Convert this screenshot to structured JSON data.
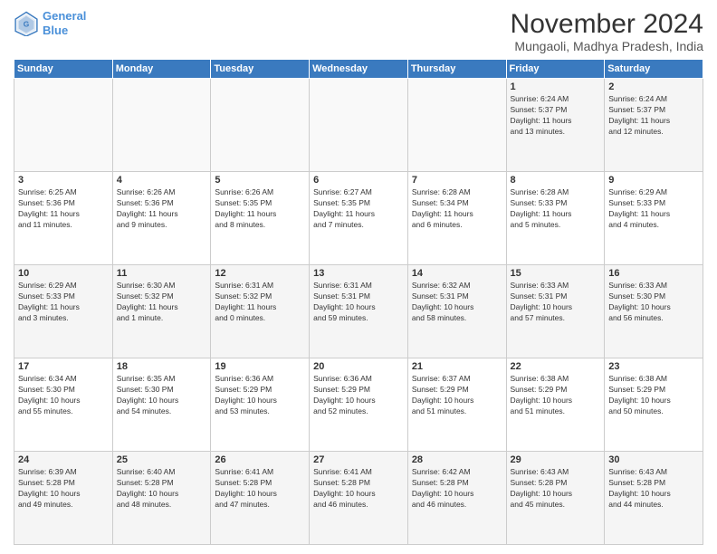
{
  "logo": {
    "line1": "General",
    "line2": "Blue"
  },
  "title": "November 2024",
  "location": "Mungaoli, Madhya Pradesh, India",
  "header": {
    "days": [
      "Sunday",
      "Monday",
      "Tuesday",
      "Wednesday",
      "Thursday",
      "Friday",
      "Saturday"
    ]
  },
  "weeks": [
    {
      "cells": [
        {
          "day": "",
          "info": ""
        },
        {
          "day": "",
          "info": ""
        },
        {
          "day": "",
          "info": ""
        },
        {
          "day": "",
          "info": ""
        },
        {
          "day": "",
          "info": ""
        },
        {
          "day": "1",
          "info": "Sunrise: 6:24 AM\nSunset: 5:37 PM\nDaylight: 11 hours\nand 13 minutes."
        },
        {
          "day": "2",
          "info": "Sunrise: 6:24 AM\nSunset: 5:37 PM\nDaylight: 11 hours\nand 12 minutes."
        }
      ]
    },
    {
      "cells": [
        {
          "day": "3",
          "info": "Sunrise: 6:25 AM\nSunset: 5:36 PM\nDaylight: 11 hours\nand 11 minutes."
        },
        {
          "day": "4",
          "info": "Sunrise: 6:26 AM\nSunset: 5:36 PM\nDaylight: 11 hours\nand 9 minutes."
        },
        {
          "day": "5",
          "info": "Sunrise: 6:26 AM\nSunset: 5:35 PM\nDaylight: 11 hours\nand 8 minutes."
        },
        {
          "day": "6",
          "info": "Sunrise: 6:27 AM\nSunset: 5:35 PM\nDaylight: 11 hours\nand 7 minutes."
        },
        {
          "day": "7",
          "info": "Sunrise: 6:28 AM\nSunset: 5:34 PM\nDaylight: 11 hours\nand 6 minutes."
        },
        {
          "day": "8",
          "info": "Sunrise: 6:28 AM\nSunset: 5:33 PM\nDaylight: 11 hours\nand 5 minutes."
        },
        {
          "day": "9",
          "info": "Sunrise: 6:29 AM\nSunset: 5:33 PM\nDaylight: 11 hours\nand 4 minutes."
        }
      ]
    },
    {
      "cells": [
        {
          "day": "10",
          "info": "Sunrise: 6:29 AM\nSunset: 5:33 PM\nDaylight: 11 hours\nand 3 minutes."
        },
        {
          "day": "11",
          "info": "Sunrise: 6:30 AM\nSunset: 5:32 PM\nDaylight: 11 hours\nand 1 minute."
        },
        {
          "day": "12",
          "info": "Sunrise: 6:31 AM\nSunset: 5:32 PM\nDaylight: 11 hours\nand 0 minutes."
        },
        {
          "day": "13",
          "info": "Sunrise: 6:31 AM\nSunset: 5:31 PM\nDaylight: 10 hours\nand 59 minutes."
        },
        {
          "day": "14",
          "info": "Sunrise: 6:32 AM\nSunset: 5:31 PM\nDaylight: 10 hours\nand 58 minutes."
        },
        {
          "day": "15",
          "info": "Sunrise: 6:33 AM\nSunset: 5:31 PM\nDaylight: 10 hours\nand 57 minutes."
        },
        {
          "day": "16",
          "info": "Sunrise: 6:33 AM\nSunset: 5:30 PM\nDaylight: 10 hours\nand 56 minutes."
        }
      ]
    },
    {
      "cells": [
        {
          "day": "17",
          "info": "Sunrise: 6:34 AM\nSunset: 5:30 PM\nDaylight: 10 hours\nand 55 minutes."
        },
        {
          "day": "18",
          "info": "Sunrise: 6:35 AM\nSunset: 5:30 PM\nDaylight: 10 hours\nand 54 minutes."
        },
        {
          "day": "19",
          "info": "Sunrise: 6:36 AM\nSunset: 5:29 PM\nDaylight: 10 hours\nand 53 minutes."
        },
        {
          "day": "20",
          "info": "Sunrise: 6:36 AM\nSunset: 5:29 PM\nDaylight: 10 hours\nand 52 minutes."
        },
        {
          "day": "21",
          "info": "Sunrise: 6:37 AM\nSunset: 5:29 PM\nDaylight: 10 hours\nand 51 minutes."
        },
        {
          "day": "22",
          "info": "Sunrise: 6:38 AM\nSunset: 5:29 PM\nDaylight: 10 hours\nand 51 minutes."
        },
        {
          "day": "23",
          "info": "Sunrise: 6:38 AM\nSunset: 5:29 PM\nDaylight: 10 hours\nand 50 minutes."
        }
      ]
    },
    {
      "cells": [
        {
          "day": "24",
          "info": "Sunrise: 6:39 AM\nSunset: 5:28 PM\nDaylight: 10 hours\nand 49 minutes."
        },
        {
          "day": "25",
          "info": "Sunrise: 6:40 AM\nSunset: 5:28 PM\nDaylight: 10 hours\nand 48 minutes."
        },
        {
          "day": "26",
          "info": "Sunrise: 6:41 AM\nSunset: 5:28 PM\nDaylight: 10 hours\nand 47 minutes."
        },
        {
          "day": "27",
          "info": "Sunrise: 6:41 AM\nSunset: 5:28 PM\nDaylight: 10 hours\nand 46 minutes."
        },
        {
          "day": "28",
          "info": "Sunrise: 6:42 AM\nSunset: 5:28 PM\nDaylight: 10 hours\nand 46 minutes."
        },
        {
          "day": "29",
          "info": "Sunrise: 6:43 AM\nSunset: 5:28 PM\nDaylight: 10 hours\nand 45 minutes."
        },
        {
          "day": "30",
          "info": "Sunrise: 6:43 AM\nSunset: 5:28 PM\nDaylight: 10 hours\nand 44 minutes."
        }
      ]
    }
  ]
}
